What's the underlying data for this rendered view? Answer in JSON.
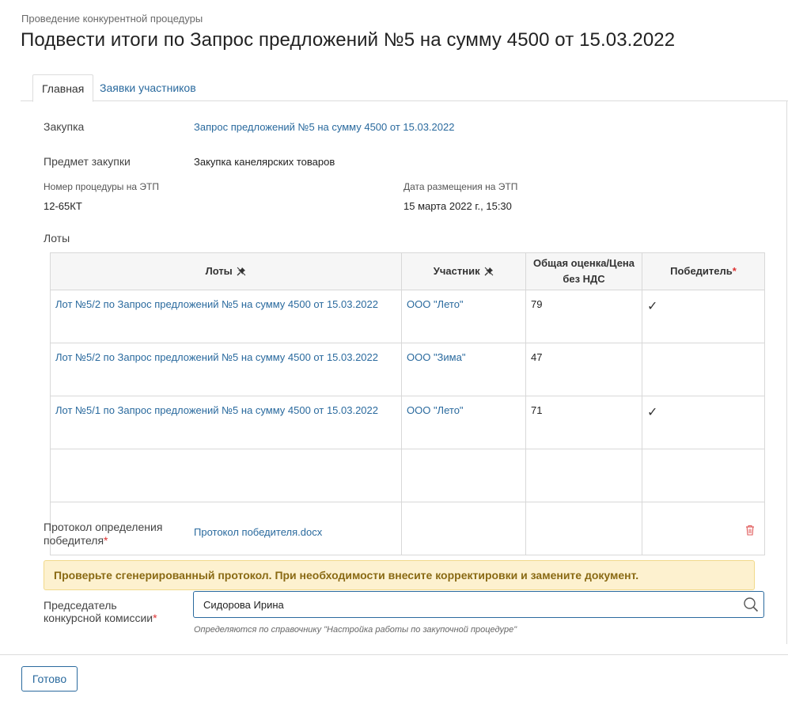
{
  "header": {
    "breadcrumb": "Проведение конкурентной процедуры",
    "title": "Подвести итоги по Запрос предложений №5 на сумму 4500 от 15.03.2022"
  },
  "tabs": [
    {
      "label": "Главная",
      "active": true
    },
    {
      "label": "Заявки участников",
      "active": false
    }
  ],
  "fields": {
    "purchase_label": "Закупка",
    "purchase_value": "Запрос предложений №5 на сумму 4500 от 15.03.2022",
    "subject_label": "Предмет закупки",
    "subject_value": "Закупка канелярских товаров",
    "etp_number_label": "Номер процедуры на ЭТП",
    "etp_number_value": "12-65КТ",
    "etp_date_label": "Дата размещения на ЭТП",
    "etp_date_value": "15 марта 2022 г., 15:30",
    "lots_label": "Лоты"
  },
  "lots_table": {
    "headers": {
      "lot": "Лоты",
      "participant": "Участник",
      "score": "Общая оценка/Цена без НДС",
      "winner": "Победитель",
      "winner_required": "*"
    },
    "rows": [
      {
        "lot": "Лот №5/2 по Запрос предложений №5 на сумму 4500 от 15.03.2022",
        "participant": "ООО \"Лето\"",
        "score": "79",
        "winner": "✓"
      },
      {
        "lot": "Лот №5/2 по Запрос предложений №5 на сумму 4500 от 15.03.2022",
        "participant": "ООО \"Зима\"",
        "score": "47",
        "winner": ""
      },
      {
        "lot": "Лот №5/1 по Запрос предложений №5 на сумму 4500 от 15.03.2022",
        "participant": "ООО \"Лето\"",
        "score": "71",
        "winner": "✓"
      }
    ]
  },
  "protocol": {
    "label_line1": "Протокол определения",
    "label_line2": "победителя",
    "required": "*",
    "file_name": "Протокол победителя.docx"
  },
  "warning": {
    "text": "Проверьте сгенерированный протокол. При необходимости внесите корректировки и замените документ."
  },
  "chairman": {
    "label_line1": "Председатель",
    "label_line2": "конкурсной комиссии",
    "required": "*",
    "value": "Сидорова Ирина",
    "hint": "Определяются по справочнику \"Настройка работы по закупочной процедуре\""
  },
  "footer": {
    "done_label": "Готово"
  },
  "colors": {
    "link": "#2a6a9e",
    "warning_bg": "#fdf1cf",
    "warning_text": "#8a6a14",
    "required": "#d33333"
  }
}
